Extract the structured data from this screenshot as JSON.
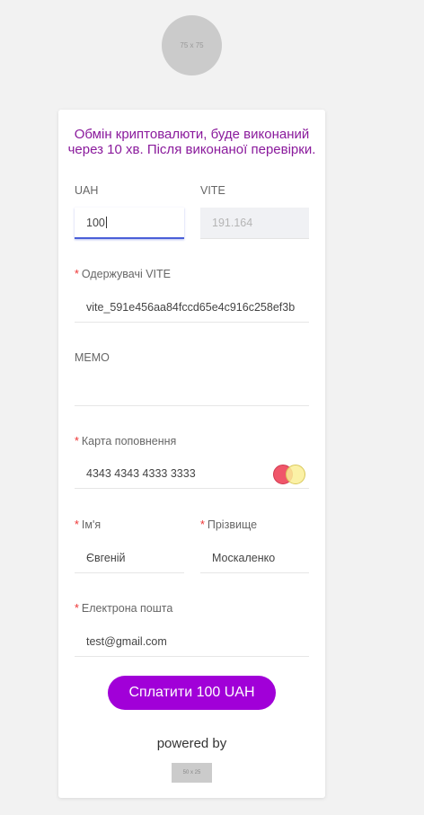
{
  "logo": {
    "placeholder": "75 x 75"
  },
  "title": "Обмін криптовалюти, буде виконаний через 10 хв. Після виконаної перевірки.",
  "from": {
    "label": "UAH",
    "value": "100"
  },
  "to": {
    "label": "VITE",
    "value": "191.164"
  },
  "recipient": {
    "label": "Одержувачі VITE",
    "value": "vite_591e456aa84fccd65e4c916c258ef3b"
  },
  "memo": {
    "label": "MEMO",
    "value": ""
  },
  "card": {
    "label": "Карта поповнення",
    "value": "4343 4343 4333 3333",
    "brand_icon": "mastercard-icon"
  },
  "first_name": {
    "label": "Ім'я",
    "value": "Євгеній"
  },
  "last_name": {
    "label": "Прізвище",
    "value": "Москаленко"
  },
  "email": {
    "label": "Електрона пошта",
    "value": "test@gmail.com"
  },
  "required_mark": "*",
  "pay_button": "Сплатити 100 UAH",
  "powered_by": "powered by",
  "provider_logo": {
    "placeholder": "50 x 25"
  },
  "colors": {
    "accent": "#a100d8",
    "title": "#8a1a9c",
    "focus": "#4a5fd8",
    "required": "#e33333"
  }
}
